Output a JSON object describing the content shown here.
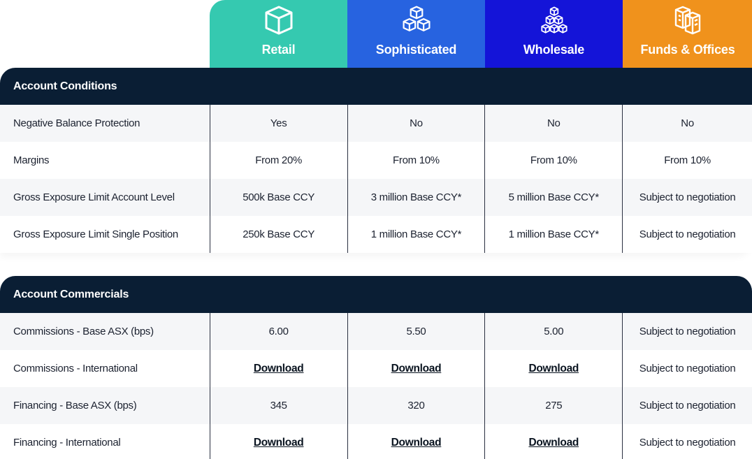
{
  "columns": [
    {
      "label": "Retail",
      "icon": "single-cube-icon",
      "color": "#35c9b0"
    },
    {
      "label": "Sophisticated",
      "icon": "three-cubes-icon",
      "color": "#2763e0"
    },
    {
      "label": "Wholesale",
      "icon": "six-cubes-icon",
      "color": "#1414d8"
    },
    {
      "label": "Funds & Offices",
      "icon": "building-cubes-icon",
      "color": "#f0921c"
    }
  ],
  "conditions": {
    "title": "Account Conditions",
    "rows": [
      {
        "name": "Negative Balance Protection",
        "values": [
          "Yes",
          "No",
          "No",
          "No"
        ]
      },
      {
        "name": "Margins",
        "values": [
          "From 20%",
          "From 10%",
          "From 10%",
          "From 10%"
        ]
      },
      {
        "name": "Gross Exposure Limit Account Level",
        "values": [
          "500k Base CCY",
          "3 million Base CCY*",
          "5 million Base CCY*",
          "Subject to negotiation"
        ]
      },
      {
        "name": "Gross Exposure Limit Single Position",
        "values": [
          "250k Base CCY",
          "1 million Base CCY*",
          "1 million Base CCY*",
          "Subject to negotiation"
        ]
      }
    ]
  },
  "commercials": {
    "title": "Account Commercials",
    "rows": [
      {
        "name": "Commissions - Base ASX (bps)",
        "values": [
          "6.00",
          "5.50",
          "5.00",
          "Subject to negotiation"
        ]
      },
      {
        "name": "Commissions - International",
        "values": [
          "Download",
          "Download",
          "Download",
          "Subject to negotiation"
        ]
      },
      {
        "name": "Financing - Base ASX (bps)",
        "values": [
          "345",
          "320",
          "275",
          "Subject to negotiation"
        ]
      },
      {
        "name": "Financing - International",
        "values": [
          "Download",
          "Download",
          "Download",
          "Subject to negotiation"
        ]
      }
    ]
  }
}
